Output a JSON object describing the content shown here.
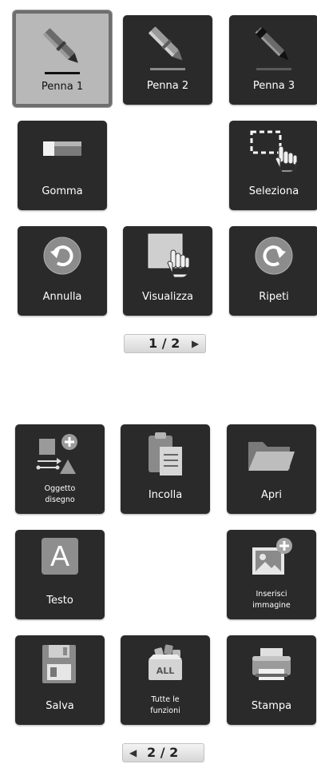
{
  "page1": {
    "tools": {
      "pen1": "Penna 1",
      "pen2": "Penna 2",
      "pen3": "Penna 3",
      "eraser": "Gomma",
      "select": "Seleziona",
      "undo": "Annulla",
      "view": "Visualizza",
      "redo": "Ripeti"
    },
    "pager": "1 / 2"
  },
  "page2": {
    "tools": {
      "draw_object": "Oggetto disegno",
      "paste": "Incolla",
      "open": "Apri",
      "text": "Testo",
      "insert_image": "Inserisci immagine",
      "save": "Salva",
      "all_functions": "Tutte le funzioni",
      "print": "Stampa"
    },
    "all_badge": "ALL",
    "text_icon_letter": "A",
    "pager": "2 / 2"
  },
  "colors": {
    "tile_background": "#2a2a2a",
    "tile_selected": "#b8b8b8",
    "button_accent": "#8c8c8c"
  }
}
